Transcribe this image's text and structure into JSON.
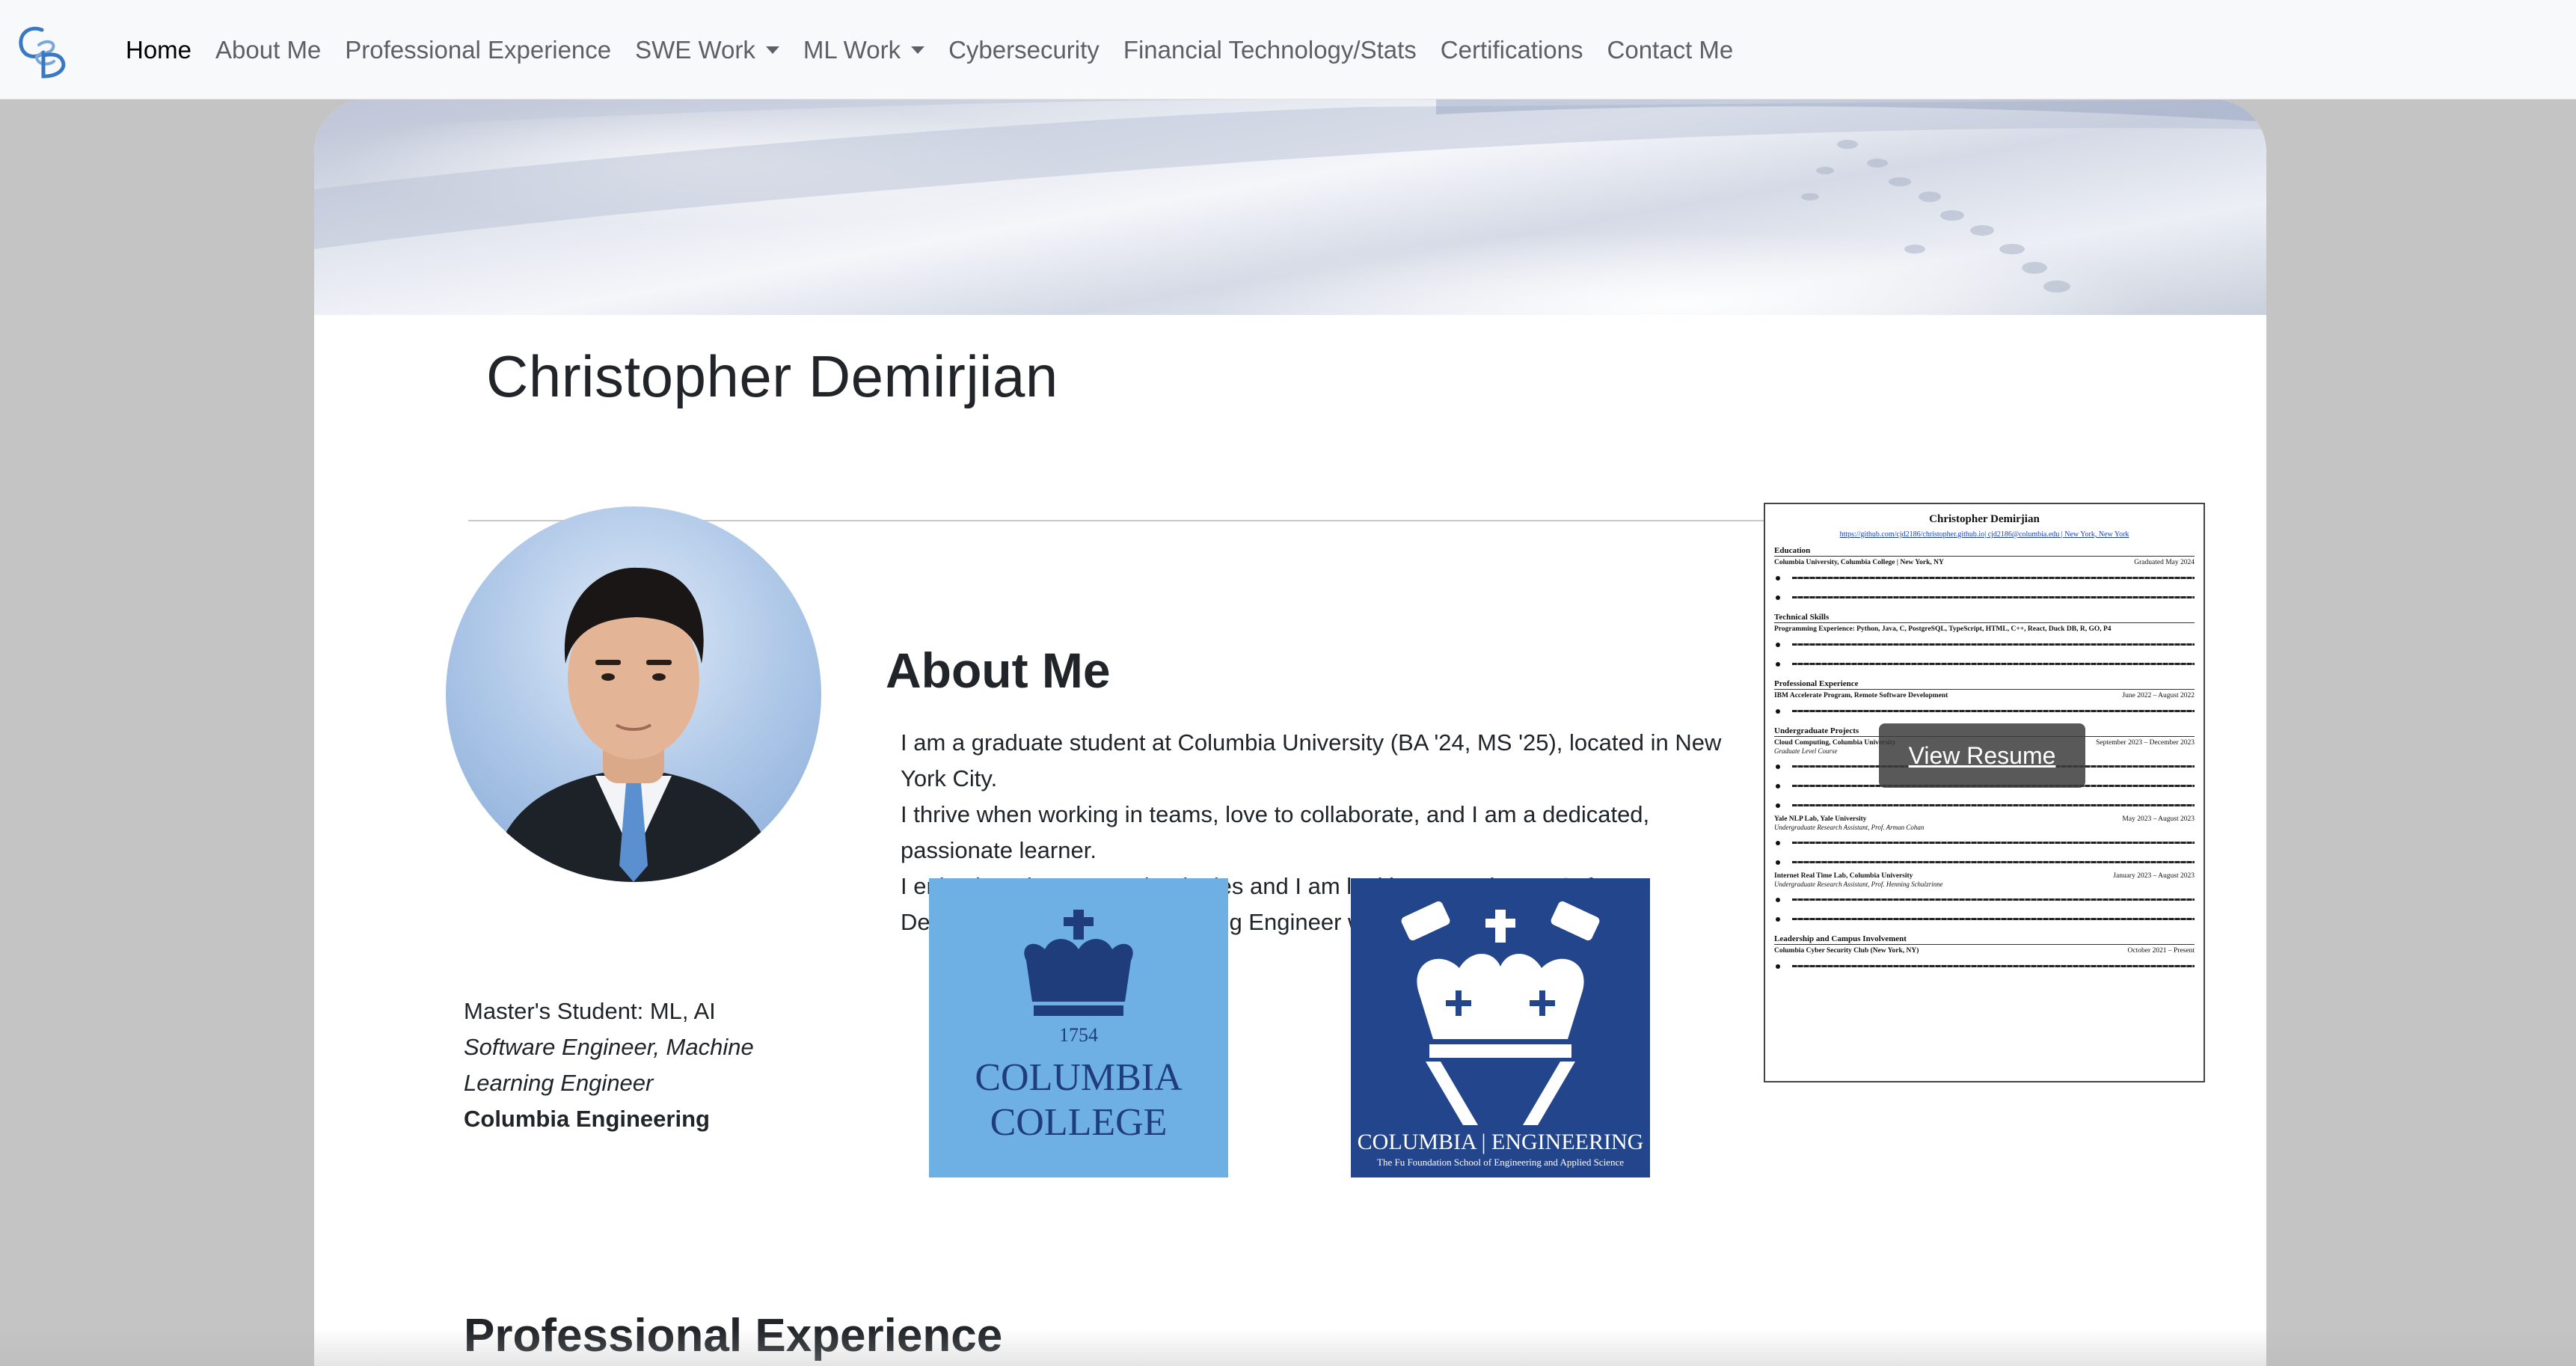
{
  "brand": {
    "logo_text": "CSD",
    "accent": "#3b78c4"
  },
  "nav": {
    "items": [
      {
        "label": "Home",
        "active": true,
        "dropdown": false
      },
      {
        "label": "About Me",
        "active": false,
        "dropdown": false
      },
      {
        "label": "Professional Experience",
        "active": false,
        "dropdown": false
      },
      {
        "label": "SWE Work",
        "active": false,
        "dropdown": true
      },
      {
        "label": "ML Work",
        "active": false,
        "dropdown": true
      },
      {
        "label": "Cybersecurity",
        "active": false,
        "dropdown": false
      },
      {
        "label": "Financial Technology/Stats",
        "active": false,
        "dropdown": false
      },
      {
        "label": "Certifications",
        "active": false,
        "dropdown": false
      },
      {
        "label": "Contact Me",
        "active": false,
        "dropdown": false
      }
    ]
  },
  "profile": {
    "name": "Christopher Demirjian",
    "caption_line1": "Master's Student: ML, AI",
    "caption_line2": "Software Engineer, Machine Learning Engineer",
    "caption_line3": "Columbia Engineering"
  },
  "about": {
    "title": "About Me",
    "p1": "I am a graduate student at Columbia University (BA '24, MS '25), located in New York City.",
    "p2": "I thrive when working in teams, love to collaborate, and I am a dedicated, passionate learner.",
    "p3": "I enjoy learning new technologies and I am looking to work as a Software Developer and Machine Learning Engineer where I can learn and grow."
  },
  "logos": {
    "college": {
      "year": "1754",
      "line1": "COLUMBIA",
      "line2": "COLLEGE",
      "bg": "#6fb0e4",
      "fg": "#1f3d7a"
    },
    "engineering": {
      "line1": "COLUMBIA | ENGINEERING",
      "line2": "The Fu Foundation School of Engineering and Applied Science",
      "bg": "#23458c",
      "fg": "#ffffff"
    }
  },
  "resume": {
    "name": "Christopher Demirjian",
    "links": "https://github.com/cjd2186/christopher.github.io| cjd2186@columbia.edu | New York, New York",
    "sections": {
      "education": "Education",
      "edu_school": "Columbia University, Columbia College | New York, NY",
      "edu_date": "Graduated May 2024",
      "skills": "Technical Skills",
      "skills_line": "Programming Experience: Python, Java, C, PostgreSQL, TypeScript, HTML, C++, React, Duck DB, R, GO, P4",
      "prof": "Professional Experience",
      "prof_job": "IBM Accelerate Program, Remote Software Development",
      "prof_date": "June 2022 – August 2022",
      "ugrad": "Undergraduate Projects",
      "ugrad_proj": "Cloud Computing, Columbia University",
      "ugrad_sub": "Graduate Level Course",
      "ugrad_date": "September 2023 – December 2023",
      "yale": "Yale NLP Lab, Yale University",
      "yale_sub": "Undergraduate Research Assistant, Prof. Arman Cohan",
      "yale_date": "May 2023 – August 2023",
      "irt": "Internet Real Time Lab, Columbia University",
      "irt_sub": "Undergraduate Research Assistant, Prof. Henning Schulzrinne",
      "irt_date": "January 2023 – August 2023",
      "lead": "Leadership and Campus Involvement",
      "lead_club": "Columbia Cyber Security Club (New York, NY)",
      "lead_date": "October 2021 – Present"
    },
    "button": "View Resume"
  },
  "next_section": {
    "title": "Professional Experience"
  }
}
